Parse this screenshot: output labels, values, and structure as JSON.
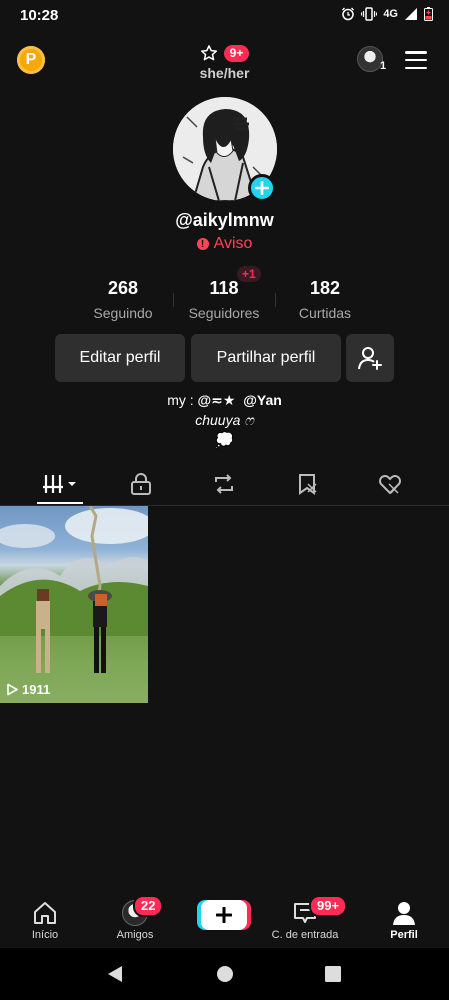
{
  "status_bar": {
    "time": "10:28",
    "network": "4G"
  },
  "top_bar": {
    "coin_label": "P",
    "notification_count": "9+",
    "pronouns": "she/her",
    "account_switch_count": "1"
  },
  "profile": {
    "username": "@aikylmnw",
    "warning_label": "Aviso",
    "stats": [
      {
        "value": "268",
        "label": "Seguindo"
      },
      {
        "value": "118",
        "label": "Seguidores",
        "badge": "+1"
      },
      {
        "value": "182",
        "label": "Curtidas"
      }
    ],
    "buttons": {
      "edit": "Editar perfil",
      "share": "Partilhar perfil"
    },
    "bio": {
      "line1_prefix": "my : ",
      "line1_handle1": "@≂★",
      "line1_handle2": "@Yan",
      "line2": "chuuya ෆ",
      "line3": "💭"
    }
  },
  "videos": [
    {
      "views": "1911"
    }
  ],
  "bottom_nav": {
    "items": [
      {
        "label": "Início"
      },
      {
        "label": "Amigos",
        "badge": "22"
      },
      {
        "label": ""
      },
      {
        "label": "C. de entrada",
        "badge": "99+"
      },
      {
        "label": "Perfil"
      }
    ]
  },
  "colors": {
    "accent_red": "#fe2c55",
    "accent_cyan": "#20d5ec",
    "coin": "#f6a70a",
    "background": "#121212"
  }
}
